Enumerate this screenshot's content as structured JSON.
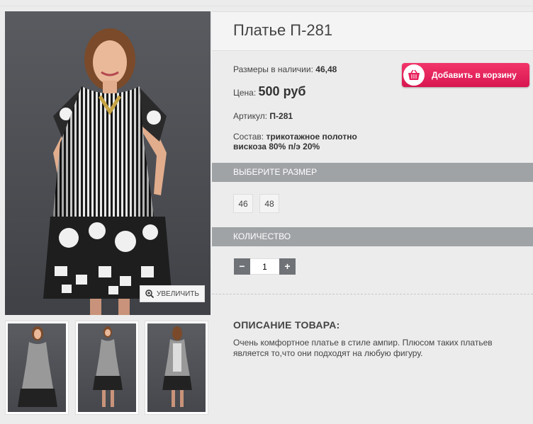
{
  "product": {
    "title": "Платье П-281",
    "sizes_available_label": "Размеры в наличии:",
    "sizes_available_value": "46,48",
    "price_label": "Цена:",
    "price_value": "500 руб",
    "sku_label": "Артикул:",
    "sku_value": "П-281",
    "composition_label": "Состав:",
    "composition_line1": "трикотажное полотно",
    "composition_line2": "вискоза 80% п/э 20%"
  },
  "cart": {
    "button_label": "Добавить в корзину"
  },
  "gallery": {
    "zoom_label": "УВЕЛИЧИТЬ"
  },
  "size_section": {
    "heading": "ВЫБЕРИТЕ РАЗМЕР",
    "options": [
      "46",
      "48"
    ]
  },
  "quantity_section": {
    "heading": "КОЛИЧЕСТВО",
    "minus": "−",
    "plus": "+",
    "value": "1"
  },
  "description": {
    "heading": "ОПИСАНИЕ ТОВАРА:",
    "text": "Очень комфортное платье в стиле ампир. Плюсом таких платьев является то,что они подходят на любую фигуру."
  },
  "colors": {
    "accent": "#e81f5b",
    "section_bar": "#a0a3a6",
    "qty_button": "#6f7276"
  }
}
